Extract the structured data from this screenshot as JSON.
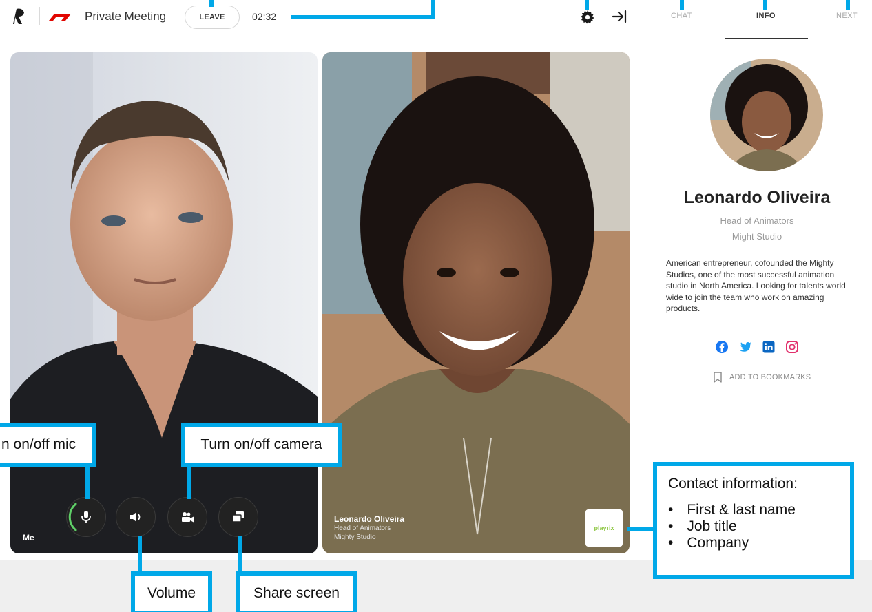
{
  "header": {
    "meeting_title": "Private Meeting",
    "leave_label": "LEAVE",
    "timer": "02:32"
  },
  "icons": {
    "logo": "app-logo-icon",
    "brand": "f1-logo-icon",
    "settings": "gear-icon",
    "collapse": "collapse-panel-icon",
    "mic": "microphone-icon",
    "volume": "speaker-icon",
    "camera": "video-camera-icon",
    "share": "share-screen-icon",
    "bookmark": "bookmark-icon"
  },
  "panel": {
    "tabs": [
      {
        "label": "CHAT",
        "active": false
      },
      {
        "label": "INFO",
        "active": true
      },
      {
        "label": "NEXT",
        "active": false
      }
    ],
    "profile": {
      "name": "Leonardo Oliveira",
      "role": "Head of Animators",
      "company": "Might Studio",
      "bio": "American entrepreneur, cofounded the Mighty Studios, one of the most successful animation studio in North America. Looking for talents world wide to join the team who work on amazing products."
    },
    "socials": [
      {
        "name": "facebook-icon",
        "color": "#1877f2"
      },
      {
        "name": "twitter-icon",
        "color": "#1da1f2"
      },
      {
        "name": "linkedin-icon",
        "color": "#0a66c2"
      },
      {
        "name": "instagram-icon",
        "color": "#e1306c"
      }
    ],
    "bookmark_label": "ADD TO BOOKMARKS"
  },
  "tiles": {
    "me_label": "Me",
    "guest": {
      "name": "Leonardo Oliveira",
      "role": "Head of Animators",
      "company": "Mighty Studio",
      "sponsor": "playrix"
    }
  },
  "callouts": {
    "mic": "n on/off mic",
    "camera": "Turn on/off camera",
    "volume": "Volume",
    "share": "Share screen",
    "contact_title": "Contact information:",
    "contact_items": [
      "First & last name",
      "Job title",
      "Company"
    ]
  },
  "colors": {
    "accent": "#00a8e8",
    "mic_active": "#5fd068",
    "brand_red": "#e10600"
  }
}
